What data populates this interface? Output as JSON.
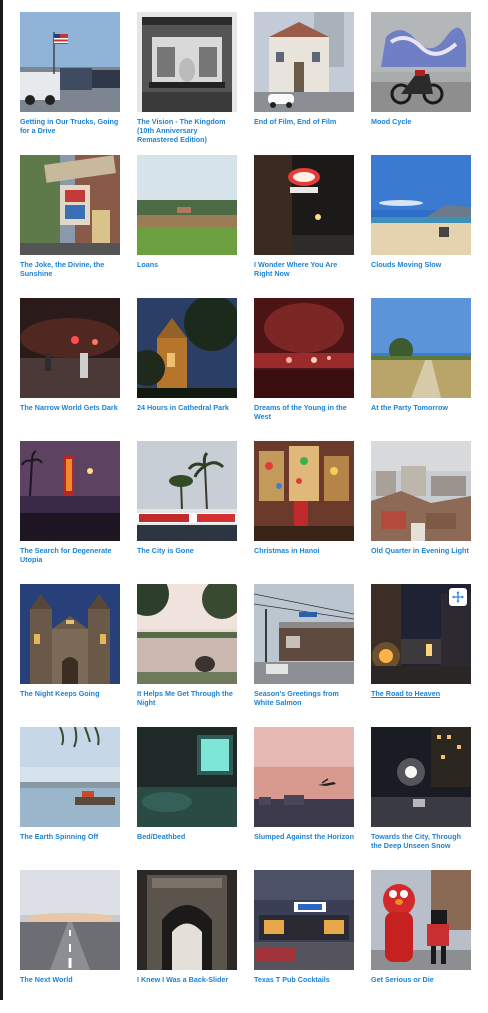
{
  "gallery": {
    "items": [
      {
        "title": "Getting in Our Trucks, Going for a Drive",
        "thumbnail": "trucks-flag-photo"
      },
      {
        "title": "The Vision - The Kingdom (10th Anniversary Remastered Edition)",
        "thumbnail": "ornate-balcony-photo"
      },
      {
        "title": "End of Film, End of Film",
        "thumbnail": "white-car-building-photo"
      },
      {
        "title": "Mood Cycle",
        "thumbnail": "graffiti-motorbike-photo"
      },
      {
        "title": "The Joke, the Divine, the Sunshine",
        "thumbnail": "street-signs-photo"
      },
      {
        "title": "Loans",
        "thumbnail": "green-field-photo"
      },
      {
        "title": "I Wonder Where You Are Right Now",
        "thumbnail": "neon-sign-night-photo"
      },
      {
        "title": "Clouds Moving Slow",
        "thumbnail": "beach-photo"
      },
      {
        "title": "The Narrow World Gets Dark",
        "thumbnail": "night-street-photo"
      },
      {
        "title": "24 Hours in Cathedral Park",
        "thumbnail": "lit-church-photo"
      },
      {
        "title": "Dreams of the Young in the West",
        "thumbnail": "red-lights-photo"
      },
      {
        "title": "At the Party Tomorrow",
        "thumbnail": "meadow-path-photo"
      },
      {
        "title": "The Search for Degenerate Utopia",
        "thumbnail": "palm-sign-dusk-photo"
      },
      {
        "title": "The City is Gone",
        "thumbnail": "palm-trees-shirts-photo"
      },
      {
        "title": "Christmas in Hanoi",
        "thumbnail": "christmas-shop-photo"
      },
      {
        "title": "Old Quarter in Evening Light",
        "thumbnail": "rooftops-photo"
      },
      {
        "title": "The Night Keeps Going",
        "thumbnail": "cathedral-photo"
      },
      {
        "title": "It Helps Me Get Through the Night",
        "thumbnail": "lake-trees-photo"
      },
      {
        "title": "Season's Greetings from White Salmon",
        "thumbnail": "power-lines-town-photo"
      },
      {
        "title": "The Road to Heaven",
        "thumbnail": "night-alley-photo",
        "hovered": true
      },
      {
        "title": "The Earth Spinning Off",
        "thumbnail": "harbor-photo"
      },
      {
        "title": "Bed/Deathbed",
        "thumbnail": "dark-room-photo"
      },
      {
        "title": "Slumped Against the Horizon",
        "thumbnail": "plane-sunset-photo"
      },
      {
        "title": "Towards the City, Through the Deep Unseen Snow",
        "thumbnail": "snowy-night-photo"
      },
      {
        "title": "The Next World",
        "thumbnail": "runway-photo"
      },
      {
        "title": "I Knew I Was a Back-Slider",
        "thumbnail": "stone-arch-photo"
      },
      {
        "title": "Texas T Pub Cocktails",
        "thumbnail": "pub-sign-photo"
      },
      {
        "title": "Get Serious or Die",
        "thumbnail": "elmo-costume-photo"
      }
    ],
    "move_handle_icon": "move-arrows-icon",
    "caption_color": "#1d83d4"
  }
}
